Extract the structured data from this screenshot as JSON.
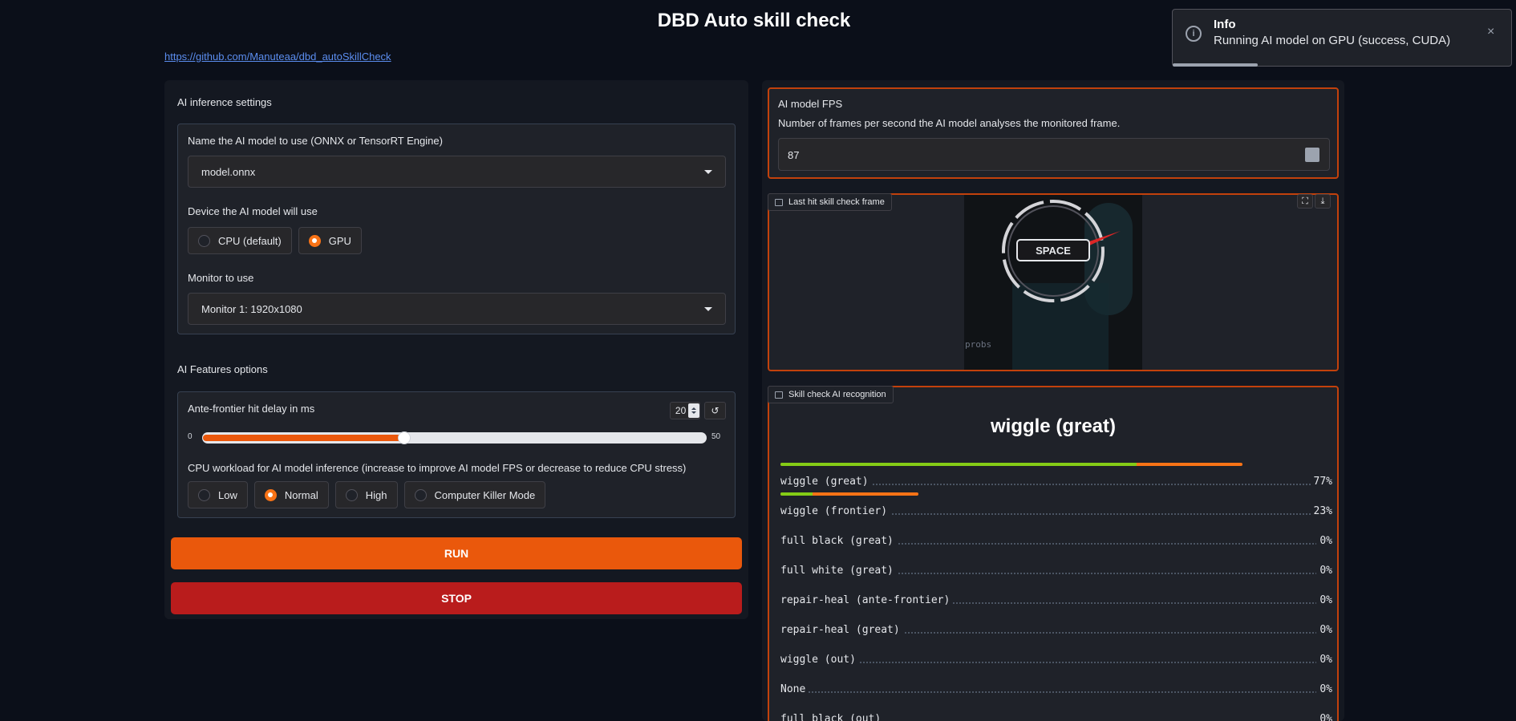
{
  "app": {
    "title": "DBD Auto skill check",
    "repo_link": "https://github.com/Manuteaa/dbd_autoSkillCheck"
  },
  "inference": {
    "section_title": "AI inference settings",
    "model_label": "Name the AI model to use (ONNX or TensorRT Engine)",
    "model_value": "model.onnx",
    "device_label": "Device the AI model will use",
    "device_options": [
      "CPU (default)",
      "GPU"
    ],
    "device_selected": "GPU",
    "monitor_label": "Monitor to use",
    "monitor_value": "Monitor 1: 1920x1080"
  },
  "features": {
    "section_title": "AI Features options",
    "delay_label": "Ante-frontier hit delay in ms",
    "delay_value": "20",
    "delay_min": "0",
    "delay_max": "50",
    "delay_fraction": 0.4,
    "cpu_label": "CPU workload for AI model inference (increase to improve AI model FPS or decrease to reduce CPU stress)",
    "cpu_options": [
      "Low",
      "Normal",
      "High",
      "Computer Killer Mode"
    ],
    "cpu_selected": "Normal"
  },
  "actions": {
    "run_label": "RUN",
    "stop_label": "STOP"
  },
  "fps": {
    "title": "AI model FPS",
    "description": "Number of frames per second the AI model analyses the monitored frame.",
    "value": "87"
  },
  "frame": {
    "label": "Last hit skill check frame",
    "key_text": "SPACE",
    "overlay_text": "probs"
  },
  "recognition": {
    "label": "Skill check AI recognition",
    "top_label": "wiggle (great)",
    "rows": [
      {
        "label": "wiggle (great)",
        "pct": "77%",
        "value": 0.77
      },
      {
        "label": "wiggle (frontier)",
        "pct": "23%",
        "value": 0.23
      },
      {
        "label": "full black (great)",
        "pct": "0%",
        "value": 0
      },
      {
        "label": "full white (great)",
        "pct": "0%",
        "value": 0
      },
      {
        "label": "repair-heal (ante-frontier)",
        "pct": "0%",
        "value": 0
      },
      {
        "label": "repair-heal (great)",
        "pct": "0%",
        "value": 0
      },
      {
        "label": "wiggle (out)",
        "pct": "0%",
        "value": 0
      },
      {
        "label": "None",
        "pct": "0%",
        "value": 0
      },
      {
        "label": "full black (out)",
        "pct": "0%",
        "value": 0
      }
    ]
  },
  "toast": {
    "title": "Info",
    "message": "Running AI model on GPU (success, CUDA)",
    "progress": 0.25
  },
  "colors": {
    "accent": "#f97316",
    "run": "#ea580c",
    "stop": "#b91c1c",
    "bar_green": "#84cc16"
  }
}
